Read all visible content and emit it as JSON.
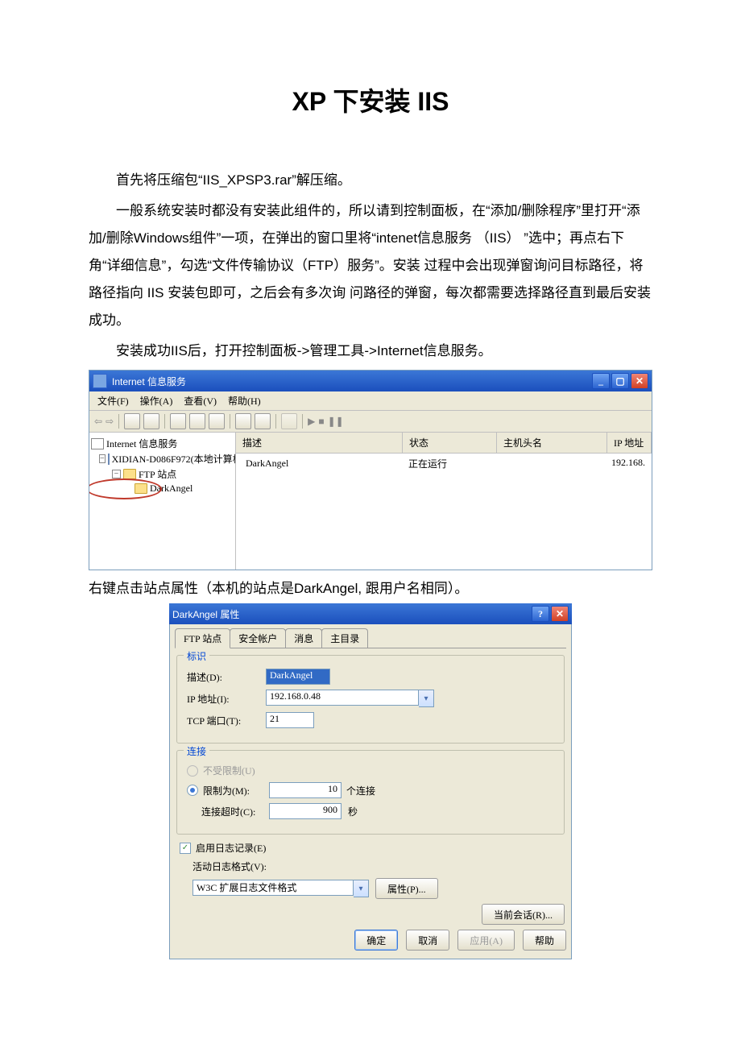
{
  "doc": {
    "title": "XP 下安装  IIS",
    "para1": "首先将压缩包“IIS_XPSP3.rar”解压缩。",
    "para2": "一般系统安装时都没有安装此组件的，所以请到控制面板，在“添加/删除程序”里打开“添加/删除Windows组件”一项，在弹出的窗口里将“intenet信息服务 （IIS） ”选中；再点右下角“详细信息”，勾选“文件传输协议（FTP）服务”。安装 过程中会出现弹窗询问目标路径，将路径指向 IIS 安装包即可，之后会有多次询 问路径的弹窗，每次都需要选择路径直到最后安装成功。",
    "para3": "安装成功IIS后，打开控制面板->管理工具->Internet信息服务。",
    "caption": "右键点击站点属性（本机的站点是DarkAngel, 跟用户名相同）。"
  },
  "iis_window": {
    "title": "Internet 信息服务",
    "menus": [
      "文件(F)",
      "操作(A)",
      "查看(V)",
      "帮助(H)"
    ],
    "tree": {
      "root": "Internet 信息服务",
      "host": "XIDIAN-D086F972(本地计算机",
      "ftp": "FTP 站点",
      "site": "DarkAngel"
    },
    "list": {
      "headers": [
        "描述",
        "状态",
        "主机头名",
        "IP 地址"
      ],
      "row": {
        "desc": "DarkAngel",
        "status": "正在运行",
        "host": "",
        "ip": "192.168."
      }
    }
  },
  "dialog": {
    "title": "DarkAngel 属性",
    "tabs": [
      "FTP 站点",
      "安全帐户",
      "消息",
      "主目录"
    ],
    "ident": {
      "label": "标识",
      "desc_label": "描述(D):",
      "desc_value": "DarkAngel",
      "ip_label": "IP 地址(I):",
      "ip_value": "192.168.0.48",
      "port_label": "TCP 端口(T):",
      "port_value": "21"
    },
    "conn": {
      "label": "连接",
      "unlimited": "不受限制(U)",
      "limited": "限制为(M):",
      "limit_value": "10",
      "limit_suffix": "个连接",
      "timeout_label": "连接超时(C):",
      "timeout_value": "900",
      "timeout_suffix": "秒"
    },
    "log": {
      "enable": "启用日志记录(E)",
      "format_label": "活动日志格式(V):",
      "format_value": "W3C 扩展日志文件格式",
      "props_btn": "属性(P)..."
    },
    "sessions_btn": "当前会话(R)...",
    "buttons": {
      "ok": "确定",
      "cancel": "取消",
      "apply": "应用(A)",
      "help": "帮助"
    }
  }
}
